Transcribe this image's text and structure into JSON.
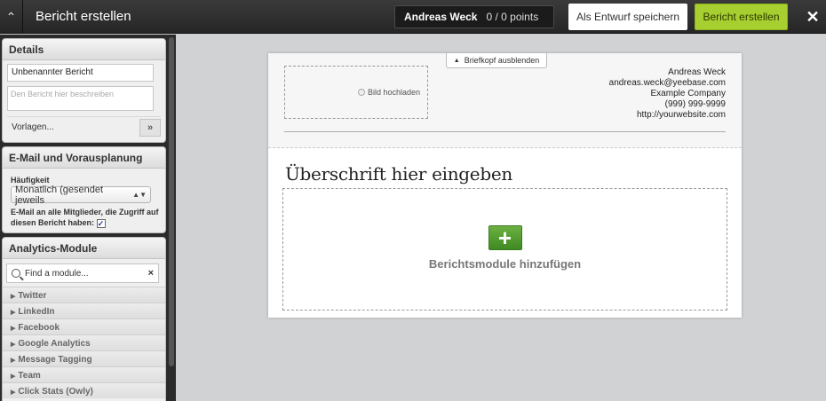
{
  "topbar": {
    "collapse_icon": "chevron-up-icon",
    "title": "Bericht erstellen",
    "user_name": "Andreas Weck",
    "points": "0 /  0 points",
    "draft_button": "Als Entwurf speichern",
    "create_button": "Bericht erstellen",
    "close_icon": "close-icon"
  },
  "details": {
    "header": "Details",
    "report_name": "Unbenannter Bericht",
    "description_placeholder": "Den Bericht hier beschreiben",
    "templates_label": "Vorlagen...",
    "templates_arrow": "»"
  },
  "email": {
    "header": "E-Mail und Vorausplanung",
    "frequency_label": "Häufigkeit",
    "frequency_value": "Monatlich (gesendet jeweils",
    "email_all_label": "E-Mail an alle Mitglieder, die Zugriff auf diesen Bericht haben:",
    "email_all_checked": true
  },
  "analytics": {
    "header": "Analytics-Module",
    "search_placeholder": "Find a module...",
    "clear_symbol": "×",
    "modules": [
      "Twitter",
      "LinkedIn",
      "Facebook",
      "Google Analytics",
      "Message Tagging",
      "Team",
      "Click Stats (Owly)"
    ]
  },
  "document": {
    "hide_header_button": "Briefkopf ausblenden",
    "upload_label": "Bild hochladen",
    "contact": [
      "Andreas Weck",
      "andreas.weck@yeebase.com",
      "Example Company",
      "(999) 999-9999",
      "http://yourwebsite.com"
    ],
    "headline": "Überschrift hier eingeben",
    "add_modules_label": "Berichtsmodule hinzufügen",
    "add_icon": "plus-icon"
  },
  "colors": {
    "accent_green": "#a7cf30",
    "add_button_green": "#4f9a2c",
    "topbar_dark": "#2f2f2f"
  }
}
